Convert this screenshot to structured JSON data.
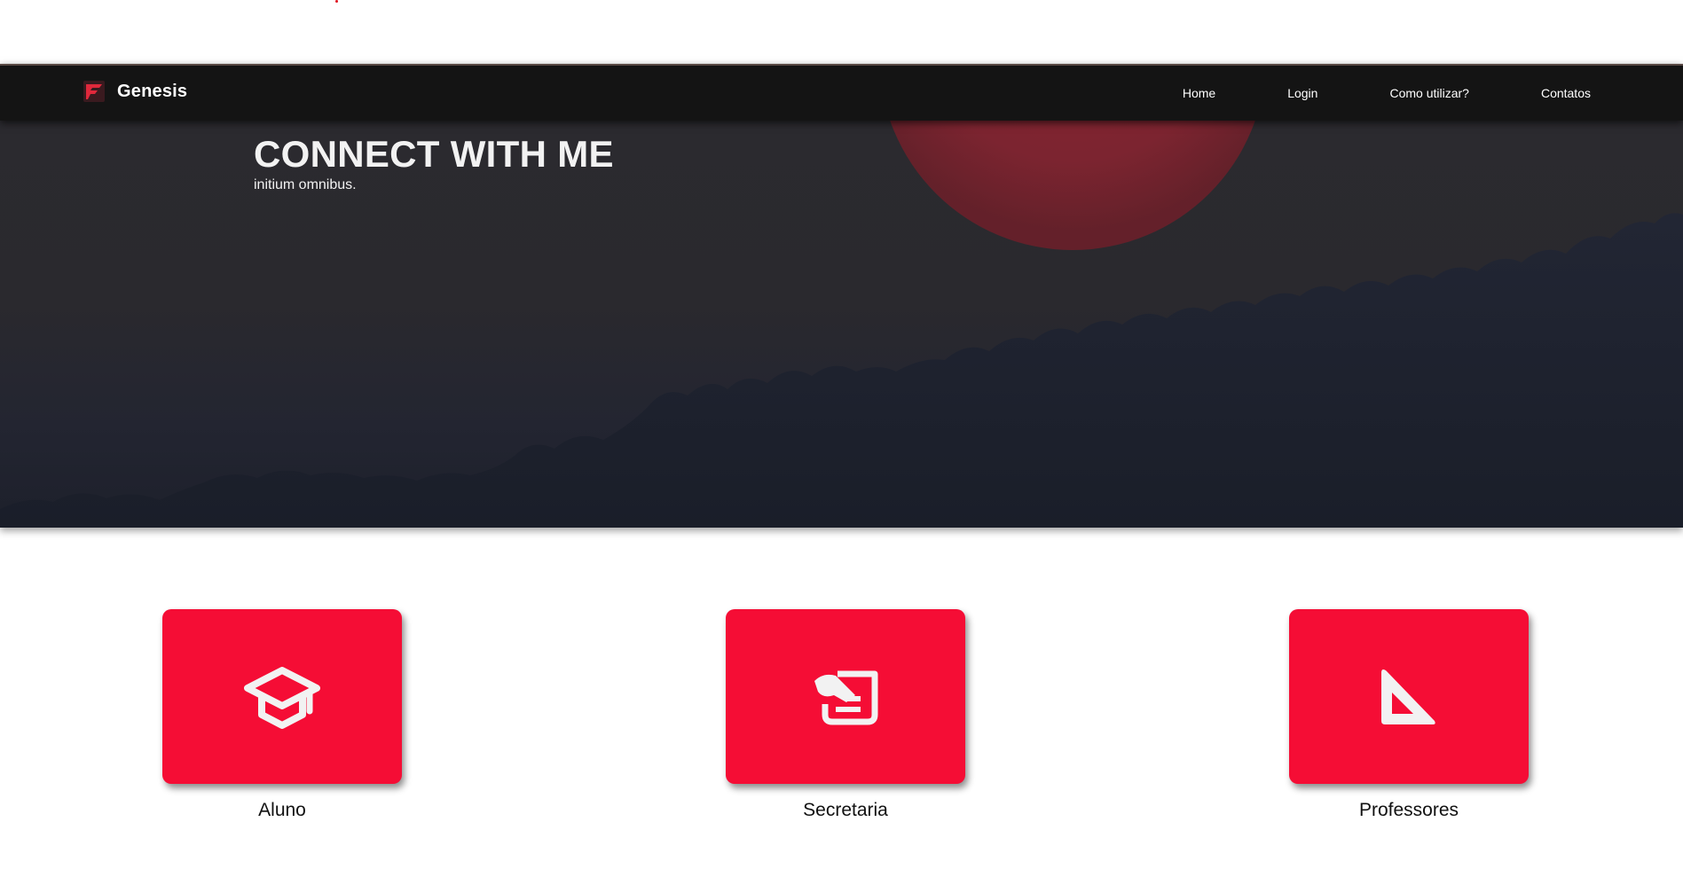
{
  "brand": {
    "name": "Genesis",
    "logo_icon": "flag-logo-icon"
  },
  "nav": {
    "items": [
      {
        "label": "Home"
      },
      {
        "label": "Login"
      },
      {
        "label": "Como utilizar?"
      },
      {
        "label": "Contatos"
      }
    ]
  },
  "hero": {
    "title": "CONNECT WITH ME",
    "subtitle": "initium omnibus."
  },
  "cards": [
    {
      "label": "Aluno",
      "icon": "graduation-cap-icon"
    },
    {
      "label": "Secretaria",
      "icon": "scroll-document-icon"
    },
    {
      "label": "Professores",
      "icon": "set-square-ruler-icon"
    }
  ],
  "colors": {
    "navbar": "#141414",
    "card_red": "#f50d35",
    "sun_red": "#8f2530",
    "hero_dark": "#2a292e"
  }
}
